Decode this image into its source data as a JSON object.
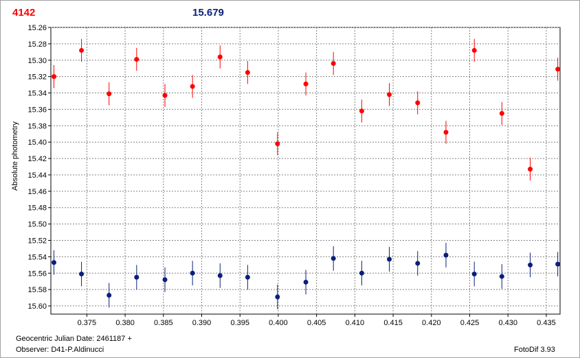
{
  "header": {
    "object_id": "4142",
    "reference_mag": "15.679"
  },
  "footer": {
    "jd_label": "Geocentric Julian Date: 2461187 +",
    "observer": "Observer: D41-P.Aldinucci",
    "software": "FotoDif 3.93"
  },
  "colors": {
    "series_red": "#ff0000",
    "series_blue": "#0a1f7a",
    "grid": "#808080",
    "background": "#ffffff"
  },
  "chart_data": {
    "type": "scatter",
    "title": "",
    "xlabel": "",
    "ylabel": "Absolute photometry",
    "xlim": [
      0.3703,
      0.4368
    ],
    "ylim": [
      15.61,
      15.26
    ],
    "y_inverted": true,
    "grid": true,
    "x_ticks": [
      0.375,
      0.38,
      0.385,
      0.39,
      0.395,
      0.4,
      0.405,
      0.41,
      0.415,
      0.42,
      0.425,
      0.43,
      0.435
    ],
    "x_tick_labels": [
      "0.375",
      "0.380",
      "0.385",
      "0.390",
      "0.395",
      "0.400",
      "0.405",
      "0.410",
      "0.415",
      "0.420",
      "0.425",
      "0.430",
      "0.435"
    ],
    "y_ticks": [
      15.26,
      15.28,
      15.3,
      15.32,
      15.34,
      15.36,
      15.38,
      15.4,
      15.42,
      15.44,
      15.46,
      15.48,
      15.5,
      15.52,
      15.54,
      15.56,
      15.58,
      15.6
    ],
    "y_tick_labels": [
      "15.26",
      "15.28",
      "15.30",
      "15.32",
      "15.34",
      "15.36",
      "15.38",
      "15.40",
      "15.42",
      "15.44",
      "15.46",
      "15.48",
      "15.50",
      "15.52",
      "15.54",
      "15.56",
      "15.58",
      "15.60"
    ],
    "x": [
      0.3707,
      0.3743,
      0.3779,
      0.3815,
      0.3852,
      0.3888,
      0.3924,
      0.396,
      0.3999,
      0.4036,
      0.4072,
      0.4109,
      0.4145,
      0.4182,
      0.4219,
      0.4256,
      0.4292,
      0.4329,
      0.4365
    ],
    "series": [
      {
        "color": "#ff0000",
        "y": [
          15.32,
          15.288,
          15.341,
          15.299,
          15.343,
          15.332,
          15.296,
          15.315,
          15.402,
          15.329,
          15.304,
          15.362,
          15.342,
          15.352,
          15.388,
          15.288,
          15.365,
          15.433,
          15.311
        ],
        "err": 0.014
      },
      {
        "color": "#0a1f7a",
        "y": [
          15.547,
          15.561,
          15.587,
          15.565,
          15.568,
          15.56,
          15.563,
          15.565,
          15.589,
          15.571,
          15.542,
          15.56,
          15.543,
          15.548,
          15.538,
          15.561,
          15.564,
          15.55,
          15.549
        ],
        "err": 0.015
      }
    ]
  }
}
